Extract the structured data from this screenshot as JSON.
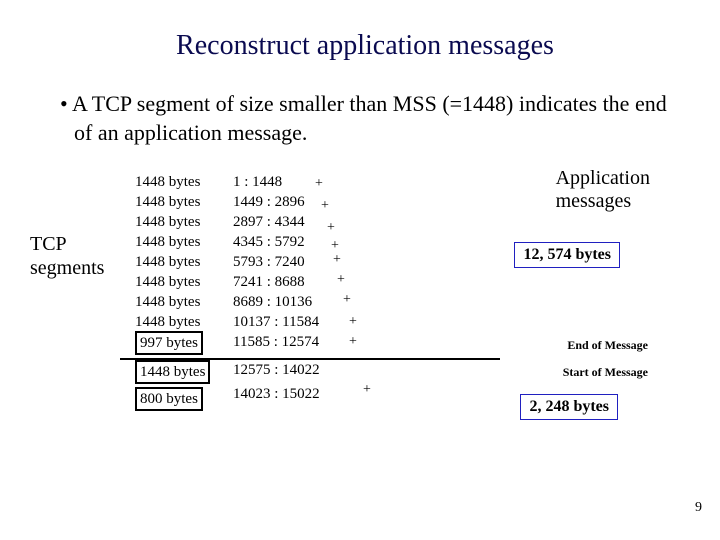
{
  "title": "Reconstruct application messages",
  "bullet": "A TCP segment of size smaller than MSS (=1448) indicates the end of an application message.",
  "tcp_label_l1": "TCP",
  "tcp_label_l2": "segments",
  "app_label_l1": "Application",
  "app_label_l2": "messages",
  "segments": {
    "s0": "1448 bytes",
    "s1": "1448 bytes",
    "s2": "1448 bytes",
    "s3": "1448 bytes",
    "s4": "1448 bytes",
    "s5": "1448 bytes",
    "s6": "1448 bytes",
    "s7": "1448 bytes",
    "s8": "997 bytes",
    "s9": "1448 bytes",
    "s10": "800 bytes"
  },
  "ranges": {
    "r0": "1 : 1448",
    "r1": "1449 : 2896",
    "r2": "2897 : 4344",
    "r3": "4345 :  5792",
    "r4": "5793 : 7240",
    "r5": "7241 : 8688",
    "r6": "8689 : 10136",
    "r7": "10137 : 11584",
    "r8": "11585 : 12574",
    "r9": "12575 : 14022",
    "r10": "14023 : 15022"
  },
  "plus": "+",
  "msg1_size": "12, 574 bytes",
  "msg2_size": "2, 248 bytes",
  "end_of_msg": "End of Message",
  "start_of_msg": "Start of Message",
  "page_num": "9"
}
